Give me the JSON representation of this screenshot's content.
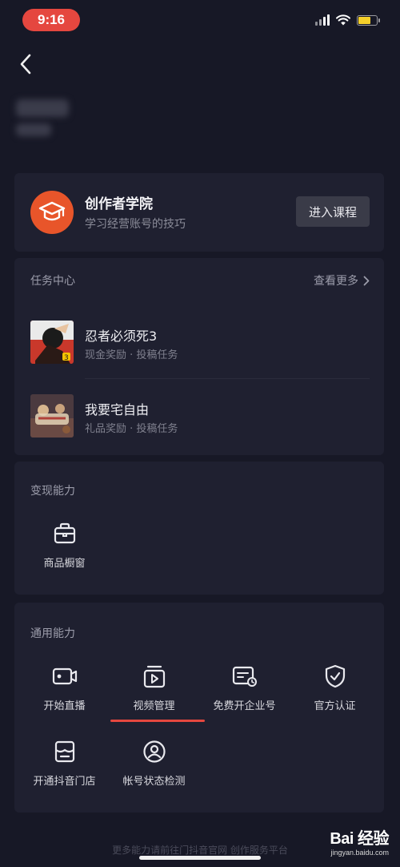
{
  "status_bar": {
    "time": "9:16",
    "accent": "#e5473f",
    "battery_level": 0.7
  },
  "nav": {
    "back_icon": "chevron-left-icon"
  },
  "academy": {
    "title": "创作者学院",
    "subtitle": "学习经营账号的技巧",
    "button": "进入课程",
    "icon": "graduation-cap-icon",
    "icon_color": "#e8552a"
  },
  "tasks": {
    "title": "任务中心",
    "more": "查看更多",
    "items": [
      {
        "name": "忍者必须死3",
        "meta": "现金奖励 · 投稿任务"
      },
      {
        "name": "我要宅自由",
        "meta": "礼品奖励 · 投稿任务"
      }
    ]
  },
  "monetize": {
    "title": "变现能力",
    "tools": [
      {
        "label": "商品橱窗",
        "icon": "shop-window-icon"
      }
    ]
  },
  "general": {
    "title": "通用能力",
    "tools": [
      {
        "label": "开始直播",
        "icon": "live-camera-icon"
      },
      {
        "label": "视频管理",
        "icon": "video-manage-icon"
      },
      {
        "label": "免费开企业号",
        "icon": "enterprise-card-icon"
      },
      {
        "label": "官方认证",
        "icon": "shield-check-icon"
      },
      {
        "label": "开通抖音门店",
        "icon": "store-icon"
      },
      {
        "label": "帐号状态检测",
        "icon": "account-check-icon"
      }
    ],
    "selected": "视频管理"
  },
  "footer": {
    "text": "更多能力请前往门抖音官网 创作服务平台",
    "watermark_logo": "Bai 经验",
    "watermark_url": "jingyan.baidu.com"
  }
}
